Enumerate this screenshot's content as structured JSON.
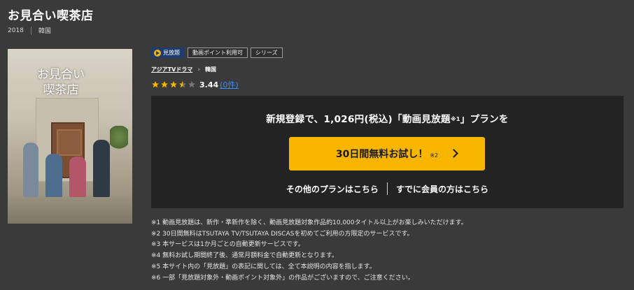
{
  "title": "お見合い喫茶店",
  "meta": {
    "year": "2018",
    "country": "韓国"
  },
  "poster": {
    "title_line1": "お見合い",
    "title_line2": "喫茶店"
  },
  "badges": {
    "primary": "見放題",
    "points": "動画ポイント利用可",
    "series": "シリーズ"
  },
  "breadcrumb": {
    "genre": "アジアTVドラマ",
    "country": "韓国"
  },
  "rating": {
    "score": "3.44",
    "count": "(0件)",
    "stars_value": 3.5,
    "stars_max": 5
  },
  "panel": {
    "headline": "新規登録で、1,026円(税込)「動画見放題",
    "headline_note": "※1",
    "headline_tail": "」プランを",
    "cta_label": "30日間無料お試し！",
    "cta_note": "※2",
    "other_plans": "その他のプランはこちら",
    "members": "すでに会員の方はこちら"
  },
  "notes": [
    "※1 動画見放題は、新作・準新作を除く、動画見放題対象作品約10,000タイトル以上がお楽しみいただけます。",
    "※2 30日間無料はTSUTAYA TV/TSUTAYA DISCASを初めてご利用の方限定のサービスです。",
    "※3 本サービスは1か月ごとの自動更新サービスです。",
    "※4 無料お試し期間終了後、通常月額料金で自動更新となります。",
    "※5 本サイト内の「見放題」の表記に関しては、全て本説明の内容を指します。",
    "※6 一部「見放題対象外・動画ポイント対象外」の作品がございますので、ご注意ください。"
  ],
  "colors": {
    "background": "#3a3a3a",
    "panel": "#232323",
    "cta": "#f8b500",
    "star": "#f5b600",
    "link_count": "#3d8ff5",
    "badge_primary": "#1e3c6e"
  },
  "icons": {
    "play_badge": "play-circle-icon",
    "chevron": "chevron-right-icon",
    "star": "star-icon"
  }
}
